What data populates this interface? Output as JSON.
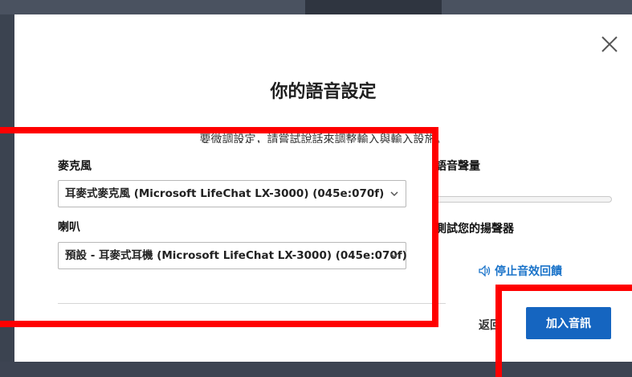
{
  "dialog": {
    "title": "你的語音設定",
    "subtitle": "要微調設定，請嘗試說話來調整輸入與輸入設施。",
    "close_icon": "close-icon"
  },
  "microphone": {
    "label": "麥克風",
    "selected": "耳麥式麥克風 (Microsoft LifeChat LX-3000) (045e:070f)"
  },
  "speaker": {
    "label": "喇叭",
    "selected": "預設 - 耳麥式耳機 (Microsoft LifeChat LX-3000) (045e:070f)"
  },
  "right_panel": {
    "volume_label": "語音聲量",
    "volume_level": 0,
    "test_label": "測試您的揚聲器",
    "feedback_link": "停止音效回饋",
    "feedback_icon": "speaker-icon"
  },
  "actions": {
    "back_label": "返回",
    "join_label": "加入音訊"
  },
  "colors": {
    "primary": "#1565c0",
    "link": "#1a73c9",
    "highlight": "#ff0000",
    "backdrop": "#3b4350"
  }
}
